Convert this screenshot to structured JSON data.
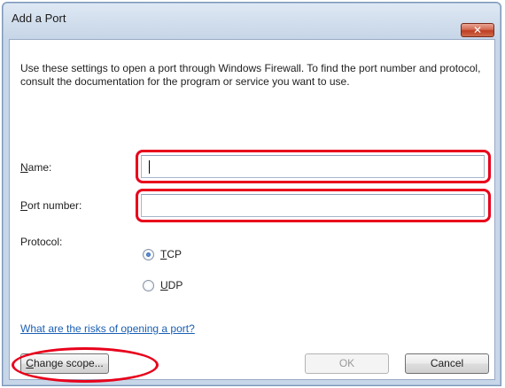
{
  "window": {
    "title": "Add a Port",
    "close_symbol": "✕"
  },
  "description": "Use these settings to open a port through Windows Firewall. To find the port number and protocol, consult the documentation for the program or service you want to use.",
  "form": {
    "name": {
      "label_prefix": "",
      "label_accel": "N",
      "label_rest": "ame:",
      "value": ""
    },
    "port": {
      "label_accel": "P",
      "label_rest": "ort number:",
      "value": ""
    },
    "protocol": {
      "label": "Protocol:",
      "options": [
        {
          "accel": "T",
          "rest": "CP",
          "selected": true
        },
        {
          "accel": "U",
          "rest": "DP",
          "selected": false
        }
      ]
    }
  },
  "link_text": "What are the risks of opening a port?",
  "buttons": {
    "change_scope": {
      "accel": "C",
      "rest": "hange scope..."
    },
    "ok": "OK",
    "cancel": "Cancel"
  },
  "colors": {
    "highlight": "#e8001b",
    "link": "#1a5fb4",
    "title_bar": "#cfdceb"
  }
}
